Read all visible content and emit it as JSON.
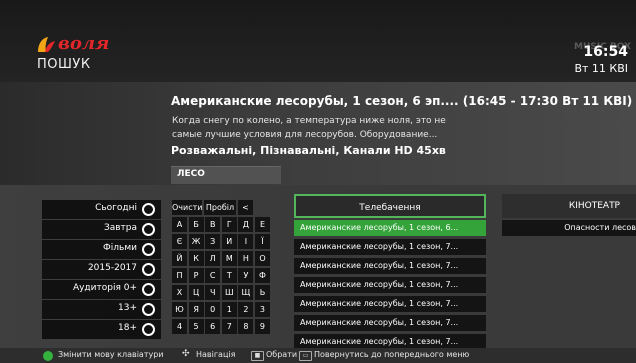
{
  "header": {
    "logo_text": "воля",
    "section_title": "ПОШУК",
    "channel_logo_text": "MUSIC BOX",
    "time": "16:54",
    "date": "Вт 11 КВІ",
    "colors": {
      "logo_red": "#e4262a",
      "logo_leaf": "#f2a417",
      "accent_green": "#33a33a"
    }
  },
  "program": {
    "title": "Американские лесорубы, 1 сезон, 6 эп....  (16:45 - 17:30 Вт 11 КВІ)",
    "description": "Когда снегу по колено, а температура ниже ноля, это не самые лучшие условия для лесорубов. Оборудование...",
    "meta": "Розважальні, Пізнавальні, Канали HD  45хв"
  },
  "search": {
    "query": "ЛЕСО"
  },
  "filters": [
    {
      "label": "Сьогодні",
      "icon": "radio-icon"
    },
    {
      "label": "Завтра",
      "icon": "radio-icon"
    },
    {
      "label": "Фільми",
      "icon": "radio-icon"
    },
    {
      "label": "2015-2017",
      "icon": "radio-icon"
    },
    {
      "label": "Аудиторія 0+",
      "icon": "radio-icon"
    },
    {
      "label": "13+",
      "icon": "radio-icon"
    },
    {
      "label": "18+",
      "icon": "radio-icon"
    }
  ],
  "keyboard": {
    "clear_label": "Очисти",
    "space_label": "Пробіл",
    "backspace_label": "<",
    "rows": [
      [
        "А",
        "Б",
        "В",
        "Г",
        "Д",
        "Е"
      ],
      [
        "Є",
        "Ж",
        "З",
        "И",
        "І",
        "Ї"
      ],
      [
        "Й",
        "К",
        "Л",
        "М",
        "Н",
        "О"
      ],
      [
        "П",
        "Р",
        "С",
        "Т",
        "У",
        "Ф"
      ],
      [
        "Х",
        "Ц",
        "Ч",
        "Ш",
        "Щ",
        "Ь"
      ],
      [
        "Ю",
        "Я",
        "0",
        "1",
        "2",
        "3"
      ],
      [
        "4",
        "5",
        "6",
        "7",
        "8",
        "9"
      ]
    ]
  },
  "results": {
    "category": "Телебачення",
    "items": [
      "Американские лесорубы, 1 сезон, 6...",
      "Американские лесорубы, 1 сезон, 7...",
      "Американские лесорубы, 1 сезон, 7...",
      "Американские лесорубы, 1 сезон, 7...",
      "Американские лесорубы, 1 сезон, 7...",
      "Американские лесорубы, 1 сезон, 7...",
      "Американские лесорубы, 1 сезон, 7..."
    ],
    "selected_index": 0
  },
  "cinema": {
    "category": "КІНОТЕАТР",
    "items": [
      "Опасности лесов"
    ]
  },
  "footer": {
    "change_language": "Змінити мову клавіатури",
    "navigation": "Навігація",
    "select": "Обрати",
    "back": "Повернутись до попереднього меню"
  }
}
